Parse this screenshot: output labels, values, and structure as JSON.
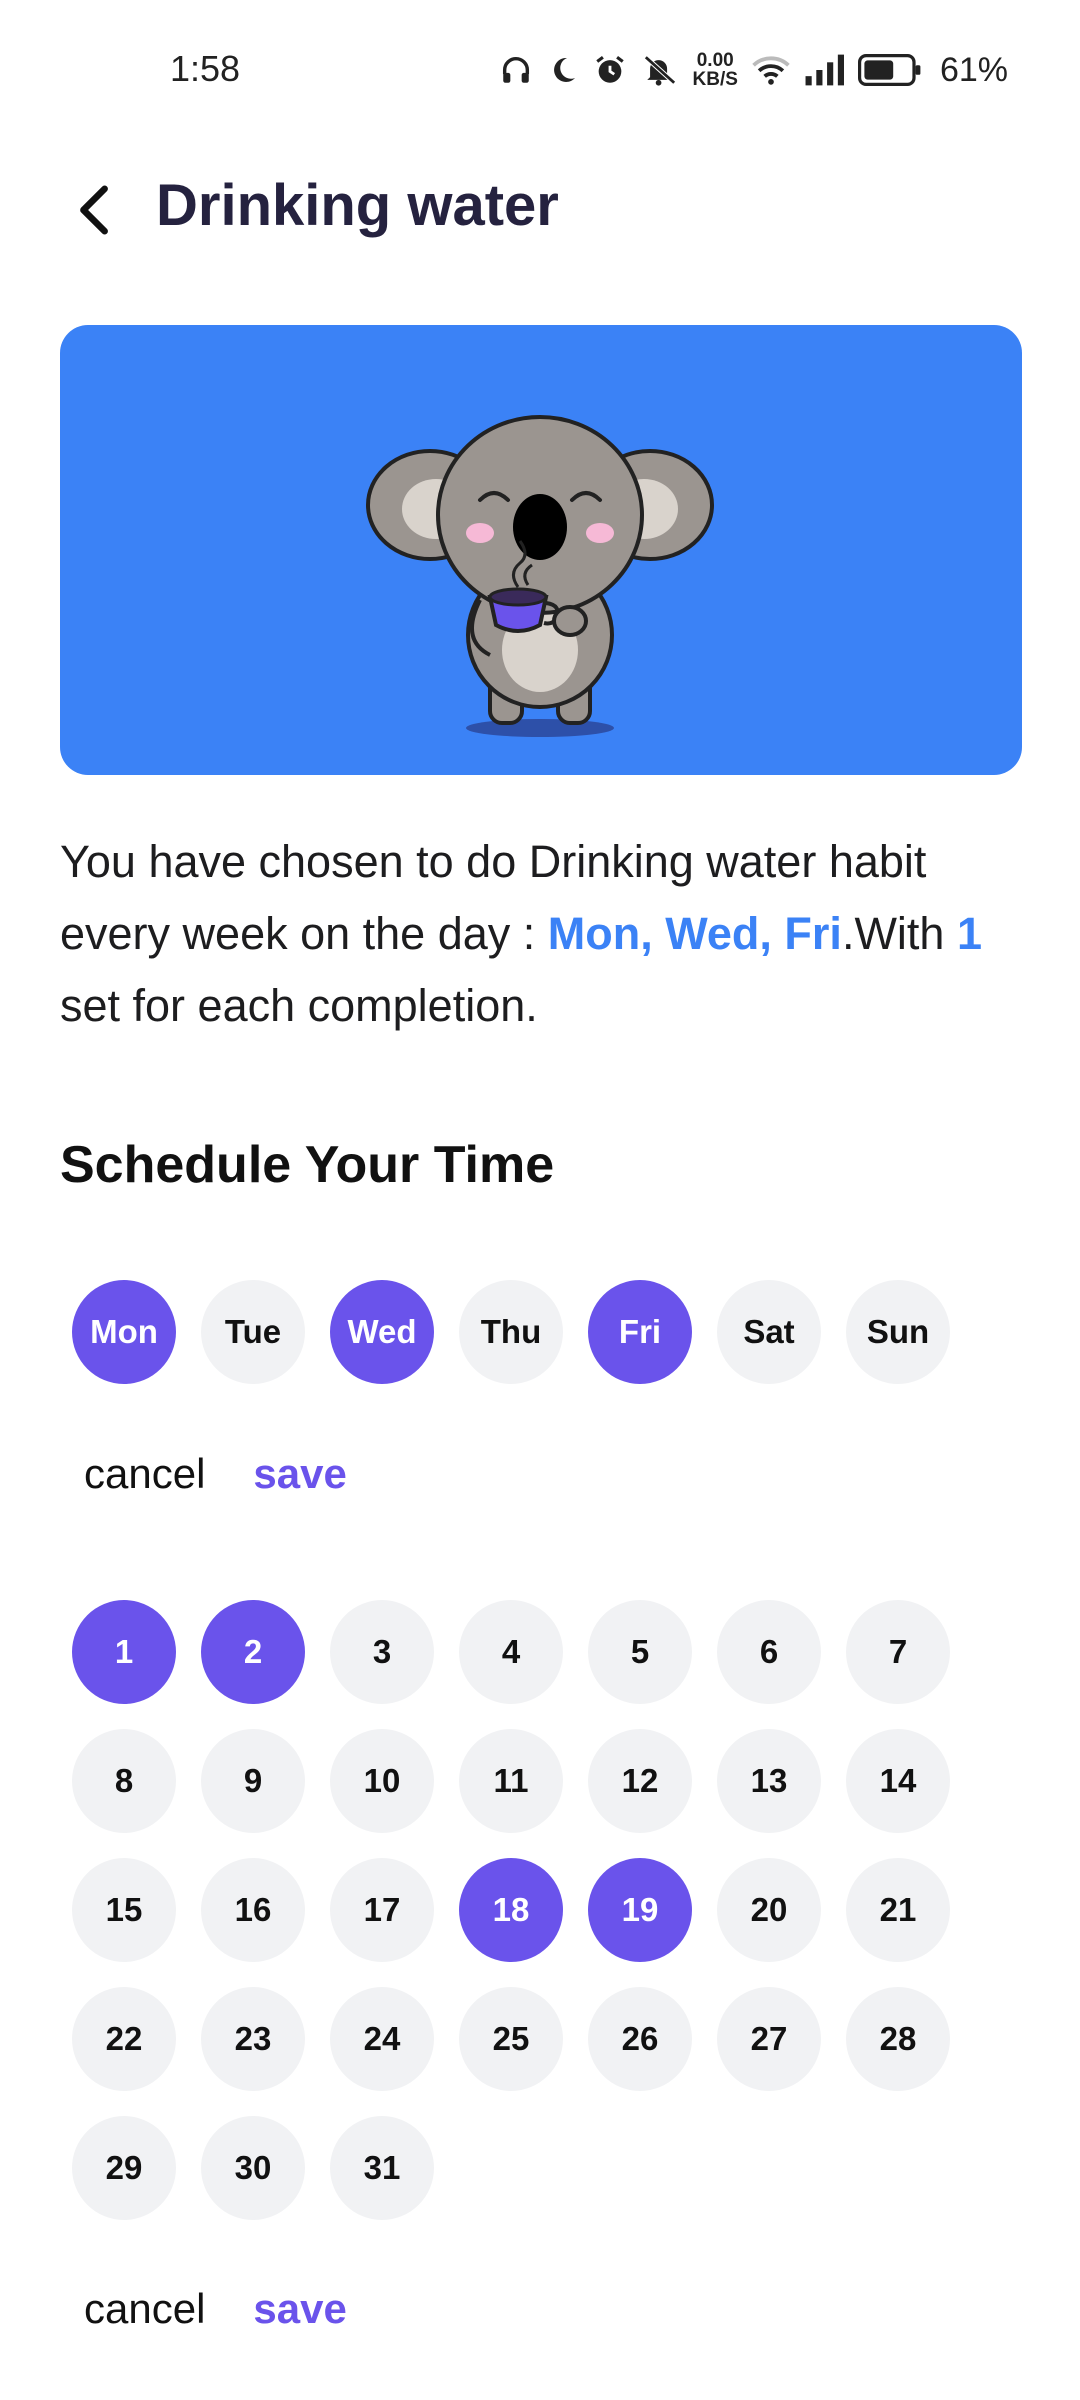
{
  "status_bar": {
    "time": "1:58",
    "net_speed_value": "0.00",
    "net_speed_unit": "KB/S",
    "battery_percent": "61%",
    "icons": [
      "headphones-icon",
      "moon-icon",
      "alarm-icon",
      "mute-icon",
      "wifi-icon",
      "signal-icon",
      "battery-icon"
    ]
  },
  "header": {
    "title": "Drinking water",
    "back_icon": "back-arrow-icon"
  },
  "banner": {
    "color": "#3b82f6",
    "illustration": "koala-drinking-coffee"
  },
  "description": {
    "part1": "You have chosen to do Drinking water habit every week on the day : ",
    "days": "Mon, Wed, Fri",
    "part2": ".With ",
    "sets": "1",
    "part3": " set for each completion."
  },
  "schedule": {
    "title": "Schedule Your Time",
    "weekdays": [
      {
        "label": "Mon",
        "selected": true
      },
      {
        "label": "Tue",
        "selected": false
      },
      {
        "label": "Wed",
        "selected": true
      },
      {
        "label": "Thu",
        "selected": false
      },
      {
        "label": "Fri",
        "selected": true
      },
      {
        "label": "Sat",
        "selected": false
      },
      {
        "label": "Sun",
        "selected": false
      }
    ],
    "weekday_actions": {
      "cancel": "cancel",
      "save": "save"
    },
    "dates": [
      {
        "label": "1",
        "selected": true
      },
      {
        "label": "2",
        "selected": true
      },
      {
        "label": "3",
        "selected": false
      },
      {
        "label": "4",
        "selected": false
      },
      {
        "label": "5",
        "selected": false
      },
      {
        "label": "6",
        "selected": false
      },
      {
        "label": "7",
        "selected": false
      },
      {
        "label": "8",
        "selected": false
      },
      {
        "label": "9",
        "selected": false
      },
      {
        "label": "10",
        "selected": false
      },
      {
        "label": "11",
        "selected": false
      },
      {
        "label": "12",
        "selected": false
      },
      {
        "label": "13",
        "selected": false
      },
      {
        "label": "14",
        "selected": false
      },
      {
        "label": "15",
        "selected": false
      },
      {
        "label": "16",
        "selected": false
      },
      {
        "label": "17",
        "selected": false
      },
      {
        "label": "18",
        "selected": true
      },
      {
        "label": "19",
        "selected": true
      },
      {
        "label": "20",
        "selected": false
      },
      {
        "label": "21",
        "selected": false
      },
      {
        "label": "22",
        "selected": false
      },
      {
        "label": "23",
        "selected": false
      },
      {
        "label": "24",
        "selected": false
      },
      {
        "label": "25",
        "selected": false
      },
      {
        "label": "26",
        "selected": false
      },
      {
        "label": "27",
        "selected": false
      },
      {
        "label": "28",
        "selected": false
      },
      {
        "label": "29",
        "selected": false
      },
      {
        "label": "30",
        "selected": false
      },
      {
        "label": "31",
        "selected": false
      }
    ],
    "date_actions": {
      "cancel": "cancel",
      "save": "save"
    }
  },
  "colors": {
    "accent": "#6a53eb",
    "highlight_text": "#3b82f6",
    "unselected_circle": "#f1f2f4",
    "title_text": "#25223f"
  }
}
